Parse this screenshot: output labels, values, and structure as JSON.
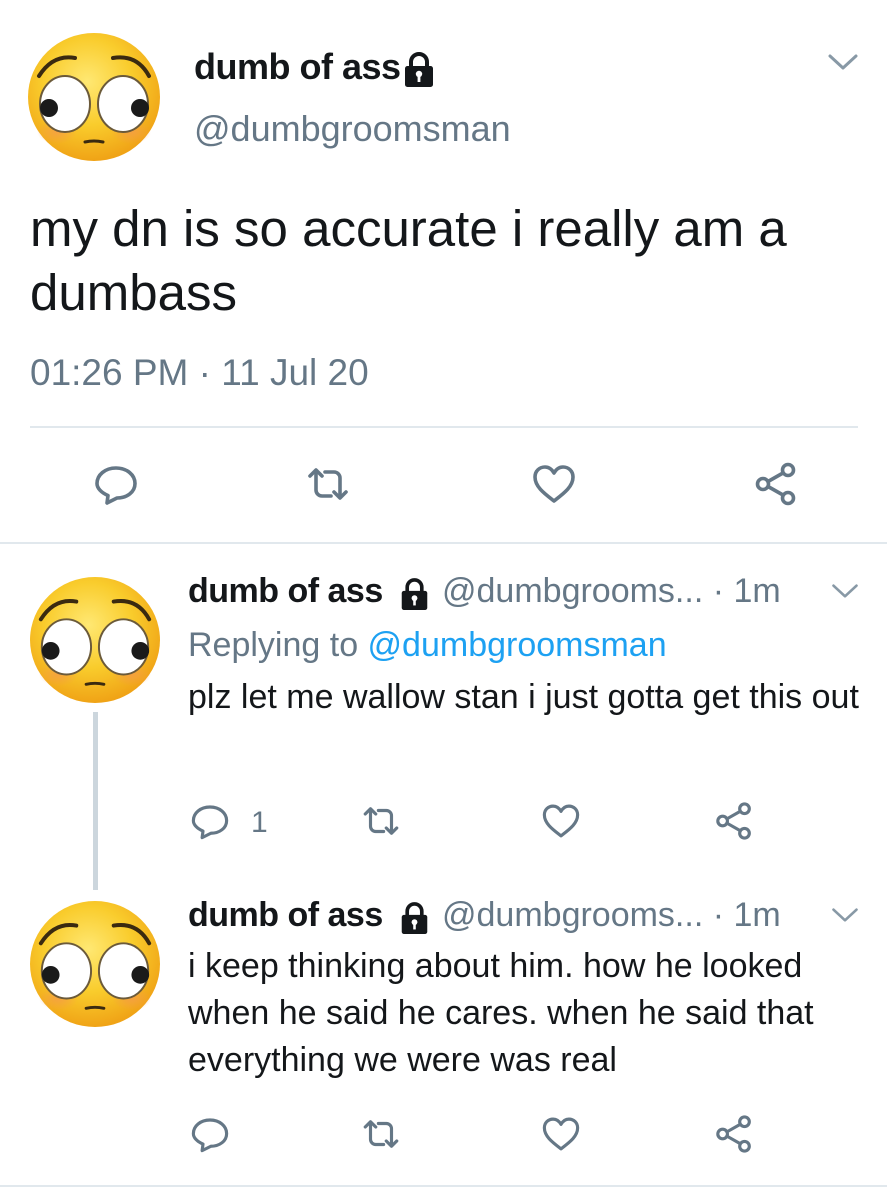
{
  "main_tweet": {
    "display_name": "dumb of ass",
    "handle": "@dumbgroomsman",
    "text": "my dn is so accurate i really am a dumbass",
    "meta": "01:26 PM · 11 Jul 20"
  },
  "replies": [
    {
      "display_name": "dumb of ass",
      "handle_time": "@dumbgrooms... · 1m",
      "replying_prefix": "Replying to ",
      "replying_mention": "@dumbgroomsman",
      "text": "plz let me wallow stan i just gotta get this out",
      "reply_count": "1"
    },
    {
      "display_name": "dumb of ass",
      "handle_time": "@dumbgrooms... · 1m",
      "text": "i keep thinking about him. how he looked when he said he cares. when he said that everything we were was real"
    }
  ],
  "icons": {
    "reply": "speech-bubble-icon",
    "retweet": "retweet-icon",
    "like": "heart-icon",
    "share": "share-icon",
    "lock": "lock-icon",
    "chevron": "chevron-down-icon"
  },
  "colors": {
    "text": "#14171a",
    "muted": "#657786",
    "link": "#1da1f2",
    "divider": "#e1e8ed",
    "thread_line": "#ccd6dd",
    "emoji_yellow": "#f8c51c"
  }
}
